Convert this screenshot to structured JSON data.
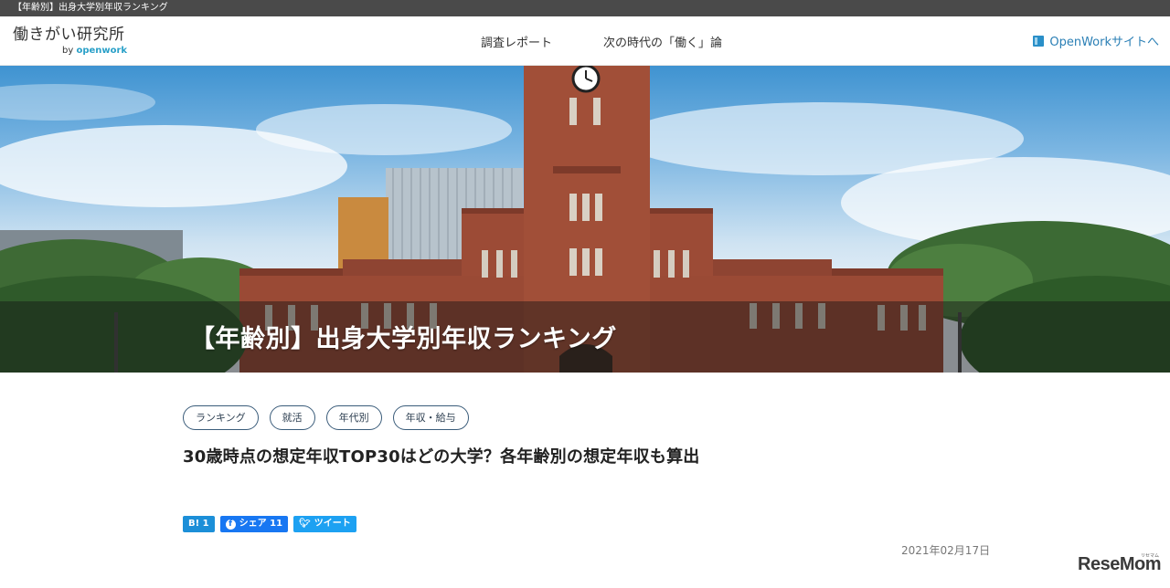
{
  "top_bar": {
    "text": "【年齢別】出身大学別年収ランキング"
  },
  "header": {
    "logo_text": "働きがい研究所",
    "logo_by": "by",
    "logo_brand": "openwork",
    "nav": [
      {
        "label": "調査レポート"
      },
      {
        "label": "次の時代の「働く」論"
      }
    ],
    "external_link": "OpenWorkサイトへ"
  },
  "hero": {
    "title": "【年齢別】出身大学別年収ランキング"
  },
  "tags": [
    {
      "label": "ランキング"
    },
    {
      "label": "就活"
    },
    {
      "label": "年代別"
    },
    {
      "label": "年収・給与"
    }
  ],
  "article": {
    "title": "30歳時点の想定年収TOP30はどの大学？各年齢別の想定年収も算出",
    "date": "2021年02月17日"
  },
  "share": {
    "hatena_label": "B! 1",
    "facebook_label": "シェア 11",
    "twitter_label": "ツイート"
  },
  "watermark": {
    "text": "ReseMom",
    "sub": "リセマム"
  },
  "colors": {
    "accent": "#2a7fb5",
    "hatena": "#1c8fd8",
    "facebook": "#1877f2",
    "twitter": "#1da1f2",
    "brick": "#9a4a35"
  }
}
